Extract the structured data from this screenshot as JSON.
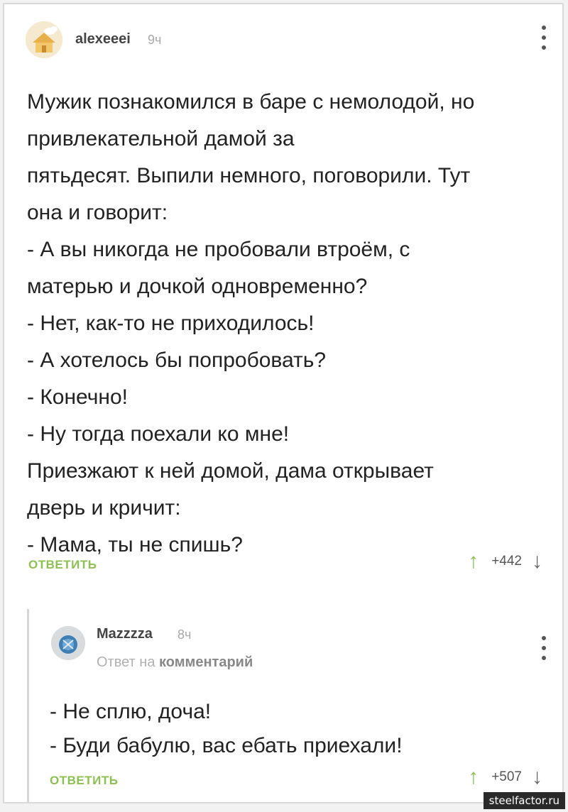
{
  "colors": {
    "accent": "#8cc152",
    "muted": "#a8a8a8",
    "text": "#222222"
  },
  "comments": [
    {
      "username": "alexeeei",
      "time": "9ч",
      "lines": [
        "Мужик познакомился в баре с немолодой, но",
        "привлекательной дамой за",
        "пятьдесят. Выпили немного, поговорили. Тут",
        "она и говорит:",
        "- А вы никогда не пробовали втроём, с",
        "матерью и дочкой одновременно?",
        "- Нет, как-то не приходилось!",
        "- А хотелось бы попробовать?",
        "- Конечно!",
        "- Ну тогда поехали ко мне!",
        "Приезжают к ней домой, дама открывает",
        "дверь и кричит:",
        "- Мама, ты не спишь?"
      ],
      "reply_label": "ОТВЕТИТЬ",
      "rating": "+442"
    },
    {
      "username": "Mazzzza",
      "time": "8ч",
      "reply_to_prefix": "Ответ на",
      "reply_to_target": "комментарий",
      "lines": [
        "- Не сплю, доча!",
        "- Буди бабулю, вас ебать приехали!"
      ],
      "reply_label": "ОТВЕТИТЬ",
      "rating": "+507"
    }
  ],
  "icons": {
    "up": "arrow-up-icon",
    "down": "arrow-down-icon",
    "menu": "kebab-menu-icon"
  },
  "watermark": "steelfactor.ru"
}
